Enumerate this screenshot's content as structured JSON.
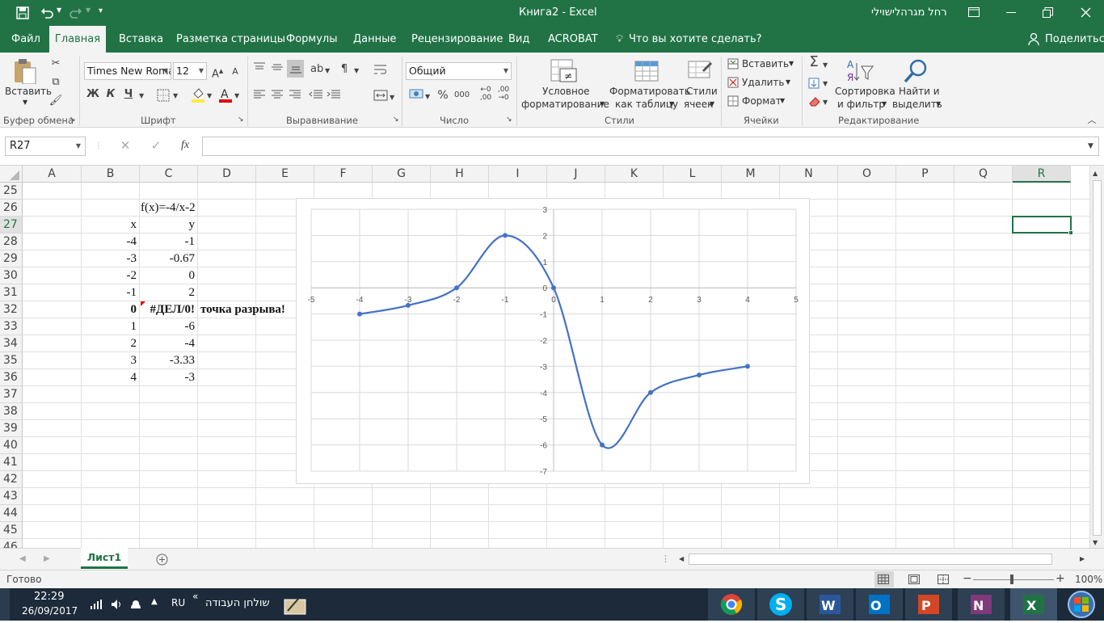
{
  "window": {
    "title": "Книга2  -  Excel",
    "user": "רחל מגרהלישוילי"
  },
  "qat": {
    "save": "save-icon",
    "undo": "undo-icon",
    "redo": "redo-icon"
  },
  "tabs": [
    "Файл",
    "Главная",
    "Вставка",
    "Разметка страницы",
    "Формулы",
    "Данные",
    "Рецензирование",
    "Вид",
    "ACROBAT"
  ],
  "tellme": "Что вы хотите сделать?",
  "share": "Поделиться",
  "ribbon": {
    "clipboard": {
      "paste": "Вставить",
      "group": "Буфер обмена"
    },
    "font": {
      "name": "Times New Roma",
      "size": "12",
      "bold": "Ж",
      "italic": "К",
      "underline": "Ч",
      "group": "Шрифт"
    },
    "alignment": {
      "group": "Выравнивание"
    },
    "number": {
      "format": "Общий",
      "percent": "%",
      "thousands": "000",
      "group": "Число"
    },
    "styles": {
      "cond1": "Условное",
      "cond2": "форматирование",
      "table1": "Форматировать",
      "table2": "как таблицу",
      "cell1": "Стили",
      "cell2": "ячеек",
      "group": "Стили"
    },
    "cells": {
      "insert": "Вставить",
      "delete": "Удалить",
      "format": "Формат",
      "group": "Ячейки"
    },
    "editing": {
      "sort1": "Сортировка",
      "sort2": "и фильтр",
      "find1": "Найти и",
      "find2": "выделить",
      "group": "Редактирование"
    }
  },
  "formula_bar": {
    "name_box": "R27",
    "fx": "fx",
    "value": ""
  },
  "columns": [
    "A",
    "B",
    "C",
    "D",
    "E",
    "F",
    "G",
    "H",
    "I",
    "J",
    "K",
    "L",
    "M",
    "N",
    "O",
    "P",
    "Q",
    "R"
  ],
  "rows": [
    "25",
    "26",
    "27",
    "28",
    "29",
    "30",
    "31",
    "32",
    "33",
    "34",
    "35",
    "36",
    "37",
    "38",
    "39",
    "40",
    "41",
    "42",
    "43",
    "44",
    "45",
    "46"
  ],
  "cells": {
    "c26": "f(x)=-4/x-2",
    "b27": "x",
    "c27": "y",
    "x": [
      "-4",
      "-3",
      "-2",
      "-1",
      "0",
      "1",
      "2",
      "3",
      "4"
    ],
    "y": [
      "-1",
      "-0.67",
      "0",
      "2",
      "#ДЕЛ/0!",
      "-6",
      "-4",
      "-3.33",
      "-3"
    ],
    "d32": "точка разрыва!"
  },
  "sheet_tab": "Лист1",
  "status": {
    "ready": "Готово",
    "zoom": "100%"
  },
  "taskbar": {
    "time": "22:29",
    "date": "26/09/2017",
    "lang": "RU",
    "desktop": "שולחן העבודה"
  },
  "chart_data": {
    "type": "scatter",
    "smooth": true,
    "x": [
      -4,
      -3,
      -2,
      -1,
      0,
      1,
      2,
      3,
      4
    ],
    "y": [
      -1,
      -0.67,
      0,
      2,
      0,
      -6,
      -4,
      -3.33,
      -3
    ],
    "xlim": [
      -5,
      5
    ],
    "ylim": [
      -7,
      3
    ],
    "xticks": [
      "-5",
      "-4",
      "-3",
      "-2",
      "-1",
      "0",
      "1",
      "2",
      "3",
      "4",
      "5"
    ],
    "yticks": [
      "3",
      "2",
      "1",
      "0",
      "-1",
      "-2",
      "-3",
      "-4",
      "-5",
      "-6",
      "-7"
    ],
    "grid": true,
    "color": "#4472c4"
  }
}
